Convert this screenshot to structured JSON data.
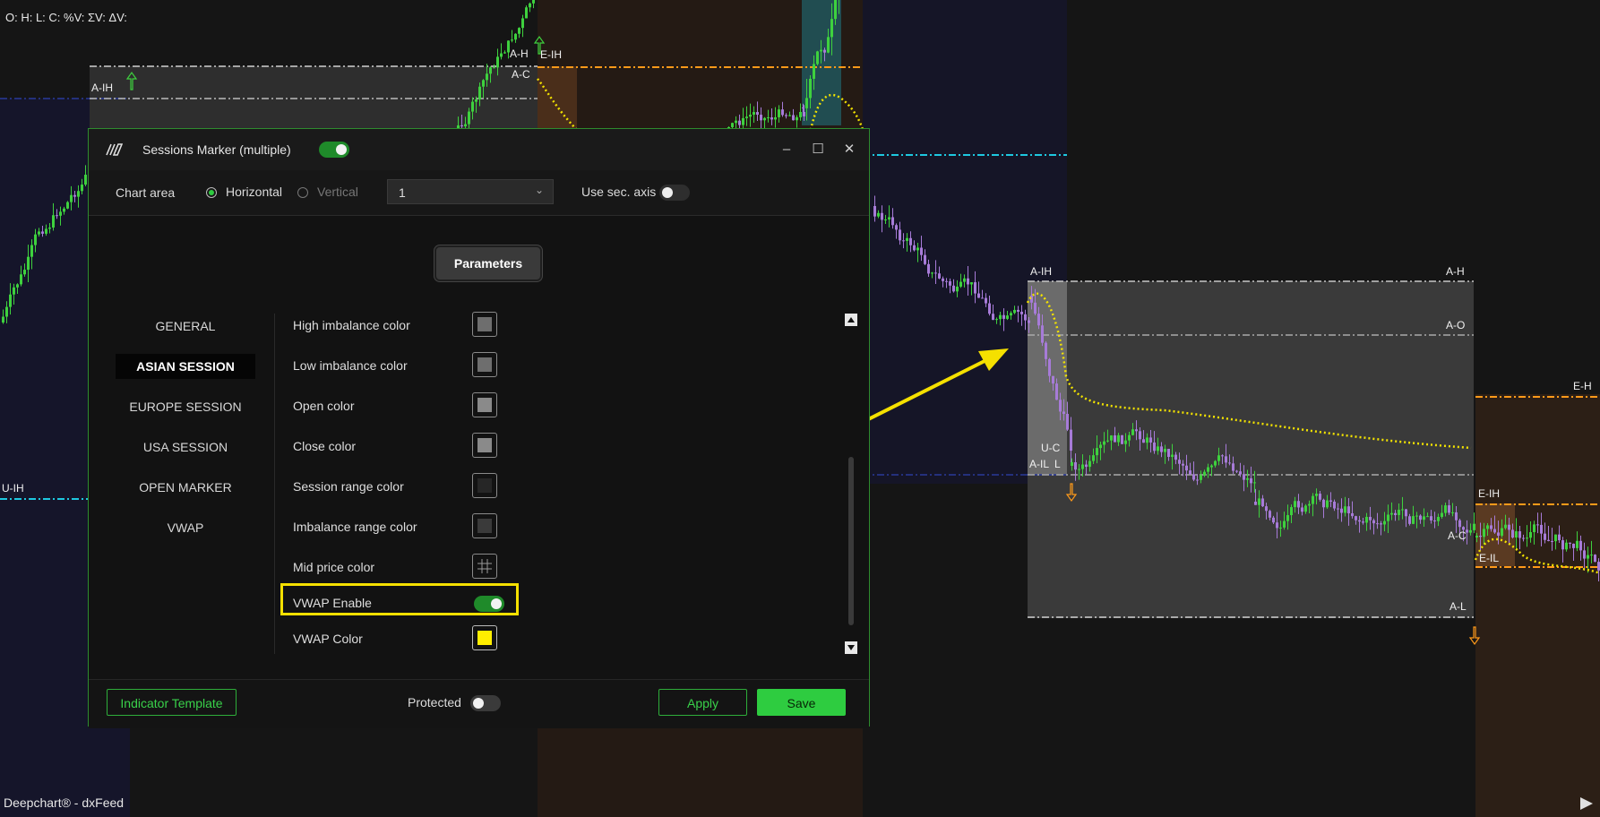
{
  "chart": {
    "ohlc_text": "O: H: L: C: %V: ΣV: ΔV:",
    "footer_text": "Deepchart® - dxFeed",
    "labels": {
      "a_ih_top": "A-IH",
      "a_h_top": "A-H",
      "e_ih_top": "E-IH",
      "a_c_top": "A-C",
      "u_ih": "U-IH",
      "a_ih": "A-IH",
      "a_h": "A-H",
      "a_o": "A-O",
      "e_h": "E-H",
      "u_c": "U-C",
      "a_il": "A-IL",
      "l": "L",
      "e_ih": "E-IH",
      "a_c": "A-C",
      "e_il": "E-IL",
      "a_l": "A-L"
    },
    "colors": {
      "bull": "#3ed13e",
      "bear": "#a77bd8",
      "vwap": "#f2e200",
      "asia_line": "#bdbdbd",
      "europe_line": "#ff9a1a",
      "usa_line": "#1fb0d6",
      "arrow": "#f5e000"
    }
  },
  "dialog": {
    "title": "Sessions Marker (multiple)",
    "enabled": true,
    "chart_area_label": "Chart area",
    "horizontal_label": "Horizontal",
    "vertical_label": "Vertical",
    "selected_orientation": "Horizontal",
    "panel_value": "1",
    "use_sec_axis_label": "Use sec. axis",
    "use_sec_axis": false,
    "parameters_label": "Parameters",
    "nav": [
      "GENERAL",
      "ASIAN SESSION",
      "EUROPE SESSION",
      "USA SESSION",
      "OPEN MARKER",
      "VWAP"
    ],
    "active_nav": "ASIAN SESSION",
    "params": [
      {
        "label": "High imbalance color",
        "color": "#6e6e6e"
      },
      {
        "label": "Low imbalance color",
        "color": "#6e6e6e"
      },
      {
        "label": "Open color",
        "color": "#8a8a8a"
      },
      {
        "label": "Close color",
        "color": "#8a8a8a"
      },
      {
        "label": "Session range color",
        "color": "#262626"
      },
      {
        "label": "Imbalance range color",
        "color": "#3a3a3a"
      },
      {
        "label": "Mid price color",
        "color": "grid"
      },
      {
        "label": "VWAP Enable",
        "toggle": true
      },
      {
        "label": "VWAP Color",
        "color": "#ffee00"
      }
    ],
    "indicator_template_label": "Indicator Template",
    "protected_label": "Protected",
    "protected": false,
    "apply_label": "Apply",
    "save_label": "Save"
  }
}
